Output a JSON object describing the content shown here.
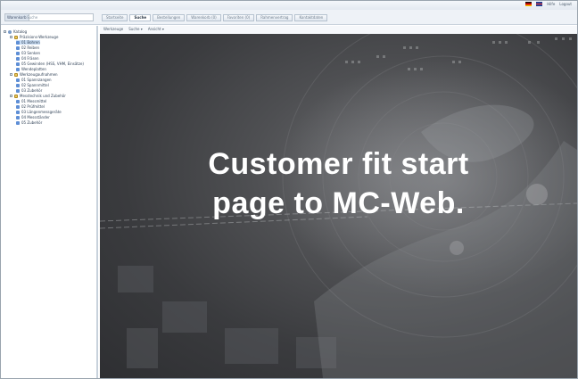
{
  "header": {
    "user_label": "Hilfe",
    "logout_label": "Logout",
    "flags": [
      "flag-de-icon",
      "flag-gb-icon"
    ]
  },
  "search": {
    "scope": "Warenkorb",
    "placeholder": "Suche"
  },
  "tabs": [
    {
      "label": "Startseite",
      "active": false
    },
    {
      "label": "Suche",
      "active": true
    },
    {
      "label": "Bestellungen",
      "active": false
    },
    {
      "label": "Warenkorb (0)",
      "active": false
    },
    {
      "label": "Favoriten (0)",
      "active": false
    },
    {
      "label": "Rahmenvertrag",
      "active": false
    },
    {
      "label": "Kontaktdaten",
      "active": false
    }
  ],
  "subbar": {
    "items": [
      "Werkzeuge",
      "Suche ▾",
      "Ansicht ▾"
    ]
  },
  "sidebar": {
    "tree": [
      {
        "label": "Katalog",
        "level": 0,
        "icon": "root-icon"
      },
      {
        "label": "Präzisions-Werkzeuge",
        "level": 1,
        "icon": "folder-icon"
      },
      {
        "label": "01 Bohren",
        "level": 2,
        "icon": "doc-icon",
        "selected": true
      },
      {
        "label": "02 Reiben",
        "level": 2,
        "icon": "doc-icon"
      },
      {
        "label": "03 Senken",
        "level": 2,
        "icon": "doc-icon"
      },
      {
        "label": "04 Fräsen",
        "level": 2,
        "icon": "doc-icon"
      },
      {
        "label": "05 Gewinden (HSS, VHM, Einsätze)",
        "level": 2,
        "icon": "doc-icon"
      },
      {
        "label": "Wendeplatten",
        "level": 2,
        "icon": "doc-icon"
      },
      {
        "label": "Werkzeugaufnahmen",
        "level": 1,
        "icon": "folder-icon"
      },
      {
        "label": "01 Spannzangen",
        "level": 2,
        "icon": "doc-icon"
      },
      {
        "label": "02 Spannmittel",
        "level": 2,
        "icon": "doc-icon"
      },
      {
        "label": "03 Zubehör",
        "level": 2,
        "icon": "doc-icon"
      },
      {
        "label": "Messtechnik und Zubehör",
        "level": 1,
        "icon": "folder-icon"
      },
      {
        "label": "01 Messmittel",
        "level": 2,
        "icon": "doc-icon"
      },
      {
        "label": "02 Prüfmittel",
        "level": 2,
        "icon": "doc-icon"
      },
      {
        "label": "03 Längenmessgeräte",
        "level": 2,
        "icon": "doc-icon"
      },
      {
        "label": "04 Messständer",
        "level": 2,
        "icon": "doc-icon"
      },
      {
        "label": "05 Zubehör",
        "level": 2,
        "icon": "doc-icon"
      }
    ]
  },
  "main": {
    "headline_line1": "Customer fit start",
    "headline_line2": "page to MC-Web."
  }
}
